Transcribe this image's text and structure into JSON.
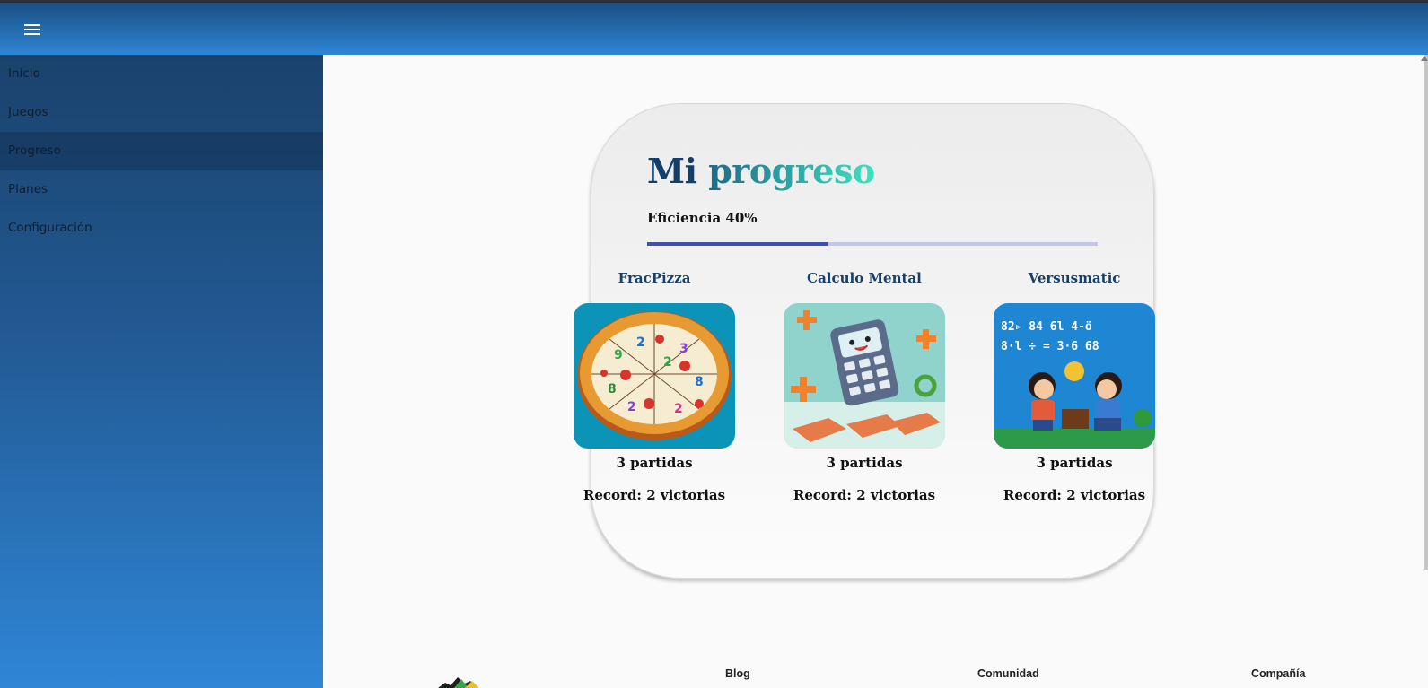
{
  "app": {
    "menu_icon": "hamburger-menu-icon",
    "brand_colors": {
      "appbar_top": "#1a4f82",
      "appbar_bottom": "#2f86d6",
      "progress_fill": "#3e4fb0",
      "progress_track": "#c2c6e8"
    }
  },
  "sidebar": {
    "items": [
      {
        "label": "Inicio"
      },
      {
        "label": "Juegos"
      },
      {
        "label": "Progreso",
        "active": true
      },
      {
        "label": "Planes"
      },
      {
        "label": "Configuración"
      }
    ]
  },
  "progress": {
    "title_part1": "Mi",
    "title_part2": "progreso",
    "efficiency_label": "Eficiencia 40%",
    "efficiency_value": 40,
    "games": [
      {
        "name": "FracPizza",
        "image": "pizza-with-numbers-illustration",
        "plays": "3 partidas",
        "record": "Record: 2 victorias"
      },
      {
        "name": "Calculo Mental",
        "image": "cartoon-calculator-illustration",
        "plays": "3 partidas",
        "record": "Record: 2 victorias"
      },
      {
        "name": "Versusmatic",
        "image": "kids-math-duel-illustration",
        "plays": "3 partidas",
        "record": "Record: 2 victorias"
      }
    ]
  },
  "footer": {
    "links": [
      {
        "label": "Blog"
      },
      {
        "label": "Comunidad"
      },
      {
        "label": "Compañía"
      }
    ],
    "logo": "brand-logo"
  }
}
